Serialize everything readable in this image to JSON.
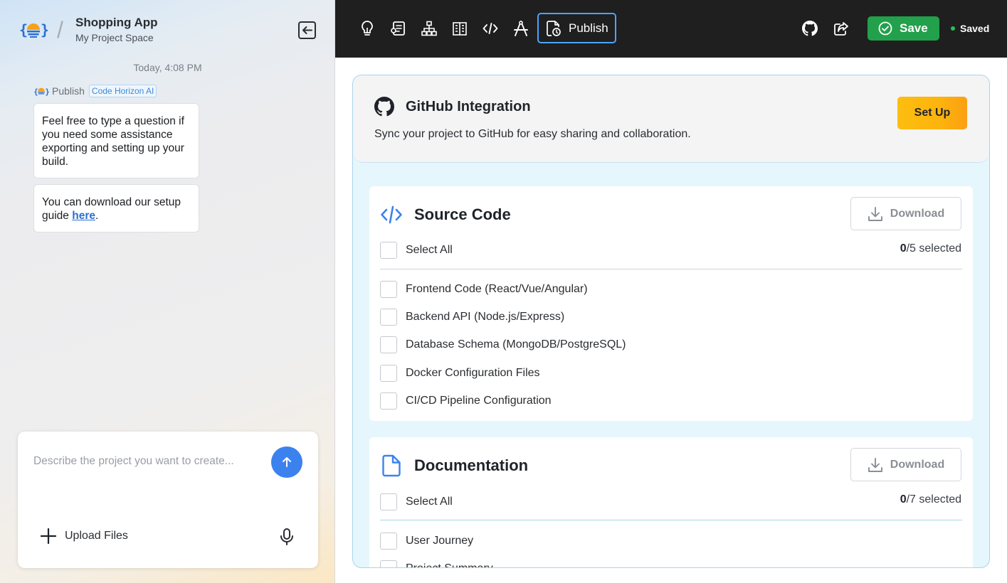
{
  "project": {
    "title": "Shopping App",
    "subtitle": "My Project Space"
  },
  "chat": {
    "timestamp": "Today, 4:08 PM",
    "sender": "Publish",
    "sender_badge": "Code Horizon AI",
    "message1": "Feel free to type a question if you need some assistance exporting and setting up your build.",
    "message2_prefix": "You can download our setup guide ",
    "message2_link": "here",
    "message2_suffix": "."
  },
  "composer": {
    "placeholder": "Describe the project you want to create...",
    "upload_label": "Upload Files"
  },
  "toolbar": {
    "icons": [
      "lightbulb-icon",
      "document-icon",
      "sitemap-icon",
      "building-icon",
      "code-icon",
      "design-icon"
    ],
    "publish_label": "Publish",
    "save_label": "Save",
    "saved_label": "Saved",
    "accent": "#4ea3ff",
    "save_color": "#22a04b"
  },
  "github": {
    "title": "GitHub Integration",
    "description": "Sync your project to GitHub for easy sharing and collaboration.",
    "setup_label": "Set Up"
  },
  "source_code": {
    "title": "Source Code",
    "download_label": "Download",
    "select_all": "Select All",
    "selected_count": "0",
    "total_suffix": "/5 selected",
    "items": [
      "Frontend Code (React/Vue/Angular)",
      "Backend API (Node.js/Express)",
      "Database Schema (MongoDB/PostgreSQL)",
      "Docker Configuration Files",
      "CI/CD Pipeline Configuration"
    ]
  },
  "documentation": {
    "title": "Documentation",
    "download_label": "Download",
    "select_all": "Select All",
    "selected_count": "0",
    "total_suffix": "/7 selected",
    "items": [
      "User Journey",
      "Project Summary"
    ]
  }
}
